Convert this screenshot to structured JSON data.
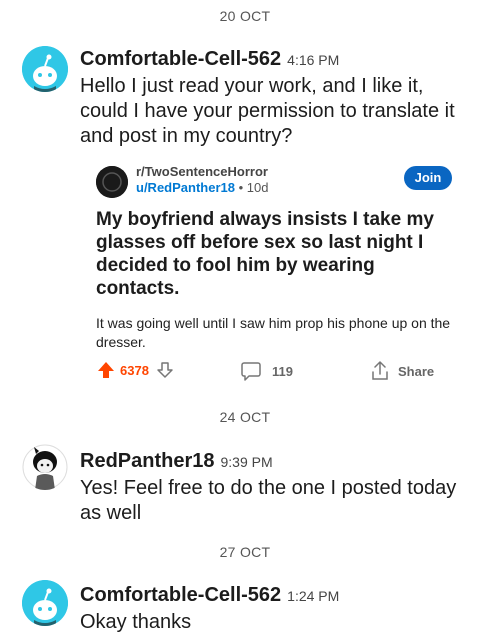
{
  "dates": [
    "20 OCT",
    "24 OCT",
    "27 OCT"
  ],
  "messages": [
    {
      "username": "Comfortable-Cell-562",
      "time": "4:16 PM",
      "text": "Hello I just read your work, and I like it, could I have your permission to translate it and post in my country?"
    },
    {
      "username": "RedPanther18",
      "time": "9:39 PM",
      "text": "Yes! Feel free to do the one I posted today as well"
    },
    {
      "username": "Comfortable-Cell-562",
      "time": "1:24 PM",
      "text": "Okay thanks"
    }
  ],
  "post": {
    "subreddit": "r/TwoSentenceHorror",
    "author": "u/RedPanther18",
    "age": "• 10d",
    "join_label": "Join",
    "title": "My boyfriend always insists I take my glasses off before sex so last night I decided to fool him by wearing contacts.",
    "body": "It was going well until I saw him prop his phone up on the dresser.",
    "upvotes": "6378",
    "comments": "119",
    "share_label": "Share"
  },
  "colors": {
    "accent_blue": "#0079d3",
    "upvote_orange": "#ff4500",
    "snoo_avatar_bg": "#2fc7e6"
  },
  "icons": [
    "snoo-avatar-icon",
    "upvote-arrow-icon",
    "downvote-arrow-icon",
    "comment-bubble-icon",
    "share-icon"
  ]
}
